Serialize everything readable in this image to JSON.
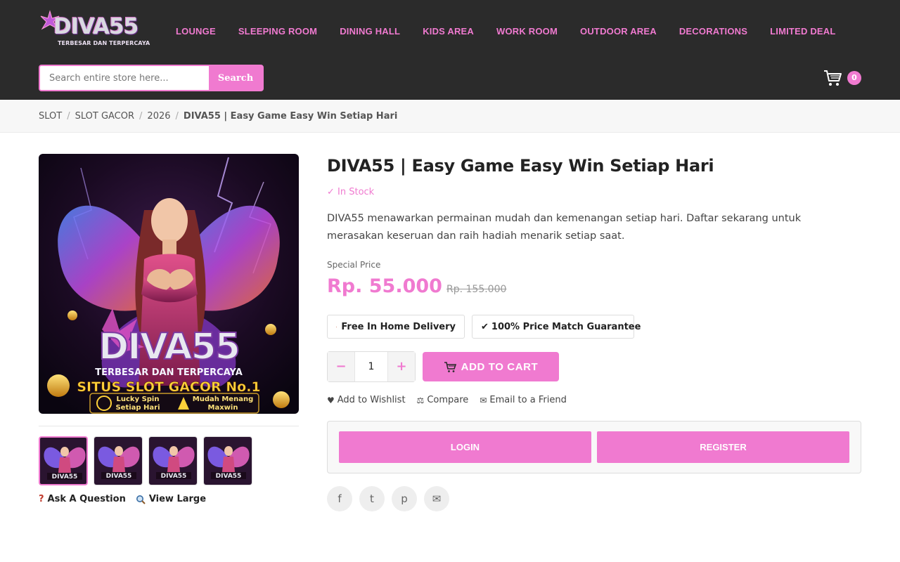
{
  "brand": {
    "logo_text": "DIVA55",
    "logo_tagline": "TERBESAR DAN TERPERCAYA"
  },
  "nav": [
    "LOUNGE",
    "SLEEPING ROOM",
    "DINING HALL",
    "KIDS AREA",
    "WORK ROOM",
    "OUTDOOR AREA",
    "DECORATIONS",
    "LIMITED DEAL"
  ],
  "search": {
    "placeholder": "Search entire store here...",
    "button": "Search"
  },
  "cart": {
    "count": "0",
    "icon": "cart-icon"
  },
  "breadcrumb": [
    "SLOT",
    "SLOT GACOR",
    "2026",
    "DIVA55 | Easy Game Easy Win Setiap Hari"
  ],
  "product": {
    "title": "DIVA55 | Easy Game Easy Win Setiap Hari",
    "stock": "✓ In Stock",
    "description": "DIVA55 menawarkan permainan mudah dan kemenangan setiap hari. Daftar sekarang untuk merasakan keseruan dan raih hadiah menarik setiap saat.",
    "price_label": "Special Price",
    "price": "Rp. 55.000",
    "old_price": "Rp. 155.000",
    "badges": [
      "Free In Home Delivery",
      "100% Price Match Guarantee"
    ],
    "quantity": "1",
    "add_to_cart": "ADD TO CART",
    "actions": [
      "Add to Wishlist",
      "Compare",
      "Email to a Friend"
    ],
    "login": "LOGIN",
    "register": "REGISTER",
    "share": [
      "f",
      "t",
      "p"
    ]
  },
  "promo_image": {
    "brand": "DIVA55",
    "tagline": "TERBESAR DAN TERPERCAYA",
    "headline": "SITUS SLOT GACOR No.1",
    "feature_1_line_1": "Lucky Spin",
    "feature_1_line_2": "Setiap Hari",
    "feature_2_line_1": "Mudah Menang",
    "feature_2_line_2": "Maxwin"
  },
  "gallery": {
    "ask": "Ask A Question",
    "view_large": "View Large"
  },
  "colors": {
    "accent": "#f07ad0",
    "header_bg": "#2b2b2b"
  }
}
